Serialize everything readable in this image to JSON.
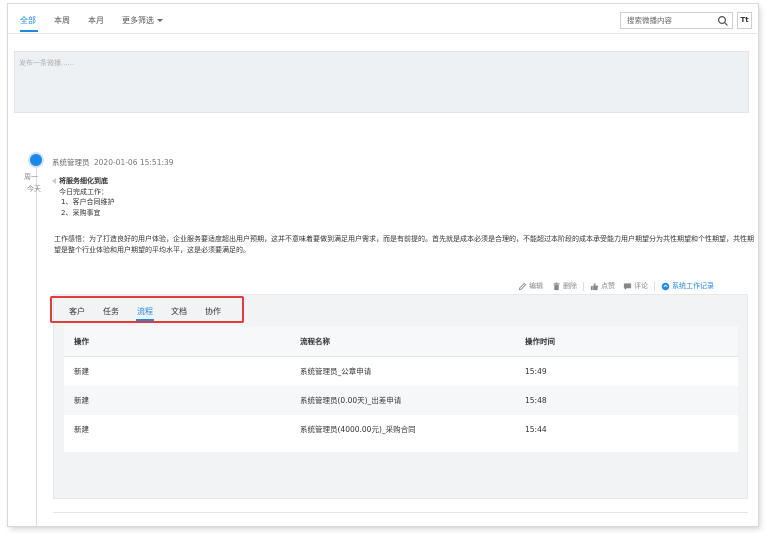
{
  "filter_tabs": [
    "全部",
    "本周",
    "本月",
    "更多筛选"
  ],
  "search": {
    "placeholder": "搜索微播内容"
  },
  "font_button": "Tt",
  "composer": {
    "placeholder": "发布一条微播......"
  },
  "post": {
    "weekday": "周一",
    "dayword": "今天",
    "author": "系统管理员",
    "datetime": "2020-01-06 15:51:39",
    "title": "将服务细化到底",
    "lines": [
      "今日完成工作：",
      "1、客户合同维护",
      "2、采购事宜"
    ],
    "desc": "工作感悟：为了打造良好的用户体验，企业服务要适度超出用户预期，这并不意味着要做到满足用户需求，而是有前提的。首先就是成本必须是合理的，不能超过本阶段的成本承受能力用户期望分为共性期望和个性期望，共性期望是整个行业体验和用户期望的平均水平，这是必须要满足的。"
  },
  "actions": {
    "edit": "编辑",
    "delete": "删除",
    "like": "点赞",
    "comment": "评论",
    "work_record": "系统工作记录"
  },
  "subtabs": [
    "客户",
    "任务",
    "流程",
    "文档",
    "协作"
  ],
  "active_subtab": "流程",
  "table": {
    "headers": [
      "操作",
      "流程名称",
      "操作时间"
    ],
    "rows": [
      [
        "新建",
        "系统管理员_公章申请",
        "15:49"
      ],
      [
        "新建",
        "系统管理员(0.00天)_出差申请",
        "15:48"
      ],
      [
        "新建",
        "系统管理员(4000.00元)_采购合同",
        "15:44"
      ]
    ]
  },
  "colors": {
    "accent": "#1e88e5",
    "highlight": "#e23b3b"
  }
}
